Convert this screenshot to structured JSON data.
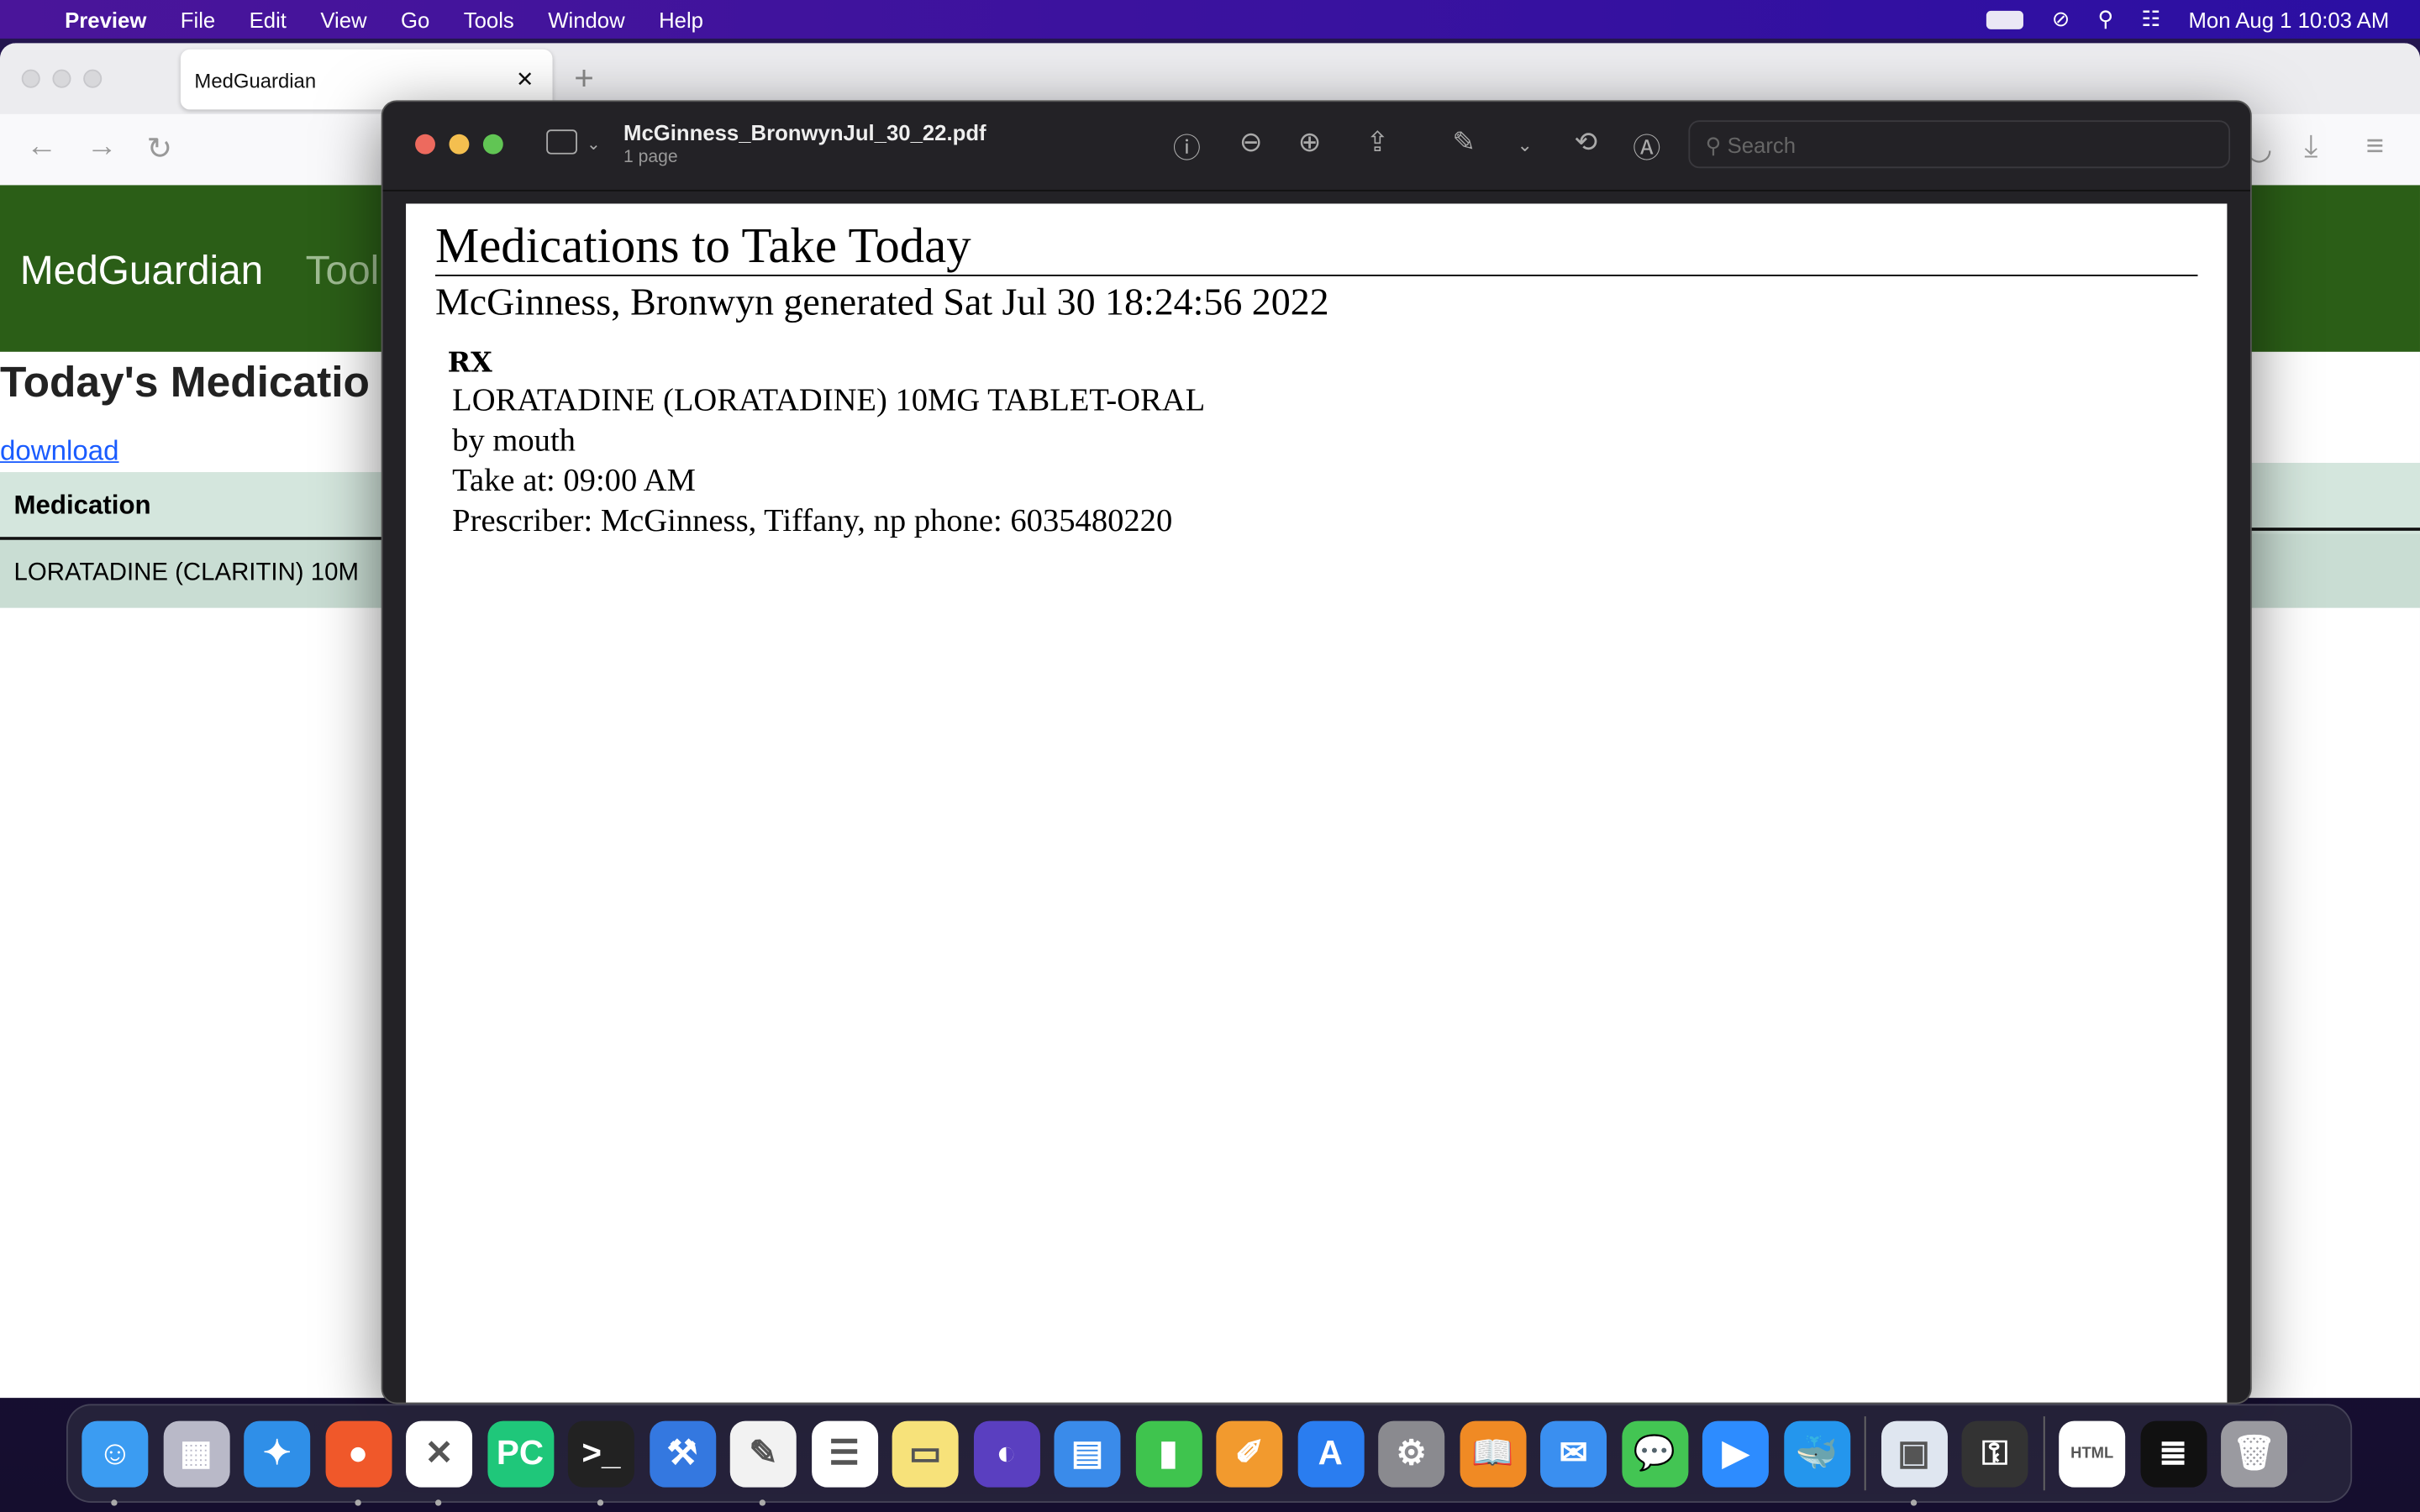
{
  "menubar": {
    "app": "Preview",
    "items": [
      "File",
      "Edit",
      "View",
      "Go",
      "Tools",
      "Window",
      "Help"
    ],
    "datetime": "Mon Aug 1  10:03 AM"
  },
  "browser": {
    "tab_title": "MedGuardian",
    "brand": "MedGuardian",
    "nav_tools": "Tool",
    "page_heading": "Today's Medicatio",
    "download_link": "download",
    "table": {
      "header": "Medication",
      "rows": [
        "LORATADINE (CLARITIN) 10M"
      ]
    }
  },
  "preview": {
    "filename": "McGinness_BronwynJul_30_22.pdf",
    "pages": "1 page",
    "search_placeholder": "Search",
    "document": {
      "title": "Medications to Take Today",
      "subtitle": "McGinness, Bronwyn generated Sat Jul 30 18:24:56 2022",
      "section": "RX",
      "lines": [
        "LORATADINE (LORATADINE) 10MG TABLET-ORAL",
        "by mouth",
        "Take at: 09:00 AM",
        "Prescriber: McGinness, Tiffany, np phone: 6035480220"
      ]
    }
  },
  "dock": {
    "apps": [
      {
        "name": "finder",
        "color": "#3b9cf2",
        "glyph": "☺",
        "running": true
      },
      {
        "name": "launchpad",
        "color": "#b9b9c8",
        "glyph": "▦",
        "running": false
      },
      {
        "name": "safari",
        "color": "#2f8fe8",
        "glyph": "✦",
        "running": false
      },
      {
        "name": "firefox",
        "color": "#f0582a",
        "glyph": "●",
        "running": true
      },
      {
        "name": "vscode",
        "color": "#ffffff",
        "glyph": "✕",
        "running": true
      },
      {
        "name": "pycharm",
        "color": "#1fc77a",
        "glyph": "PC",
        "running": false
      },
      {
        "name": "terminal",
        "color": "#222222",
        "glyph": ">_",
        "running": true
      },
      {
        "name": "xcode",
        "color": "#3478e0",
        "glyph": "⚒",
        "running": false
      },
      {
        "name": "textedit",
        "color": "#f2f2f2",
        "glyph": "✎",
        "running": true
      },
      {
        "name": "reminders",
        "color": "#ffffff",
        "glyph": "☰",
        "running": false
      },
      {
        "name": "notes",
        "color": "#f7e27a",
        "glyph": "▭",
        "running": false
      },
      {
        "name": "tor-browser",
        "color": "#5a3fc0",
        "glyph": "◐",
        "running": false
      },
      {
        "name": "keynote",
        "color": "#3a8bea",
        "glyph": "▤",
        "running": false
      },
      {
        "name": "numbers",
        "color": "#3fc44e",
        "glyph": "▮",
        "running": false
      },
      {
        "name": "pages",
        "color": "#f29a2e",
        "glyph": "✐",
        "running": false
      },
      {
        "name": "app-store",
        "color": "#2a7df0",
        "glyph": "A",
        "running": false
      },
      {
        "name": "system-preferences",
        "color": "#8a8a8f",
        "glyph": "⚙",
        "running": false
      },
      {
        "name": "books",
        "color": "#f08a24",
        "glyph": "📖",
        "running": false
      },
      {
        "name": "mail",
        "color": "#3a8ff0",
        "glyph": "✉",
        "running": false
      },
      {
        "name": "messages",
        "color": "#43c553",
        "glyph": "💬",
        "running": false
      },
      {
        "name": "zoom",
        "color": "#2d8cff",
        "glyph": "▶",
        "running": false
      },
      {
        "name": "docker",
        "color": "#2496ed",
        "glyph": "🐳",
        "running": false
      },
      {
        "name": "preview",
        "color": "#dfe6f0",
        "glyph": "▣",
        "running": true
      },
      {
        "name": "keychain-access",
        "color": "#333333",
        "glyph": "⚿",
        "running": false
      },
      {
        "name": "html-file",
        "color": "#ffffff",
        "glyph": "HTML",
        "running": false
      },
      {
        "name": "terminal-window",
        "color": "#111111",
        "glyph": "≣",
        "running": false
      },
      {
        "name": "trash",
        "color": "#9a9aa0",
        "glyph": "🗑",
        "running": false
      }
    ]
  },
  "colors": {
    "menubar": "#3a12a0",
    "brand_green": "#2b5e17",
    "table_header": "#d4e6dd",
    "link": "#1a5cff"
  }
}
